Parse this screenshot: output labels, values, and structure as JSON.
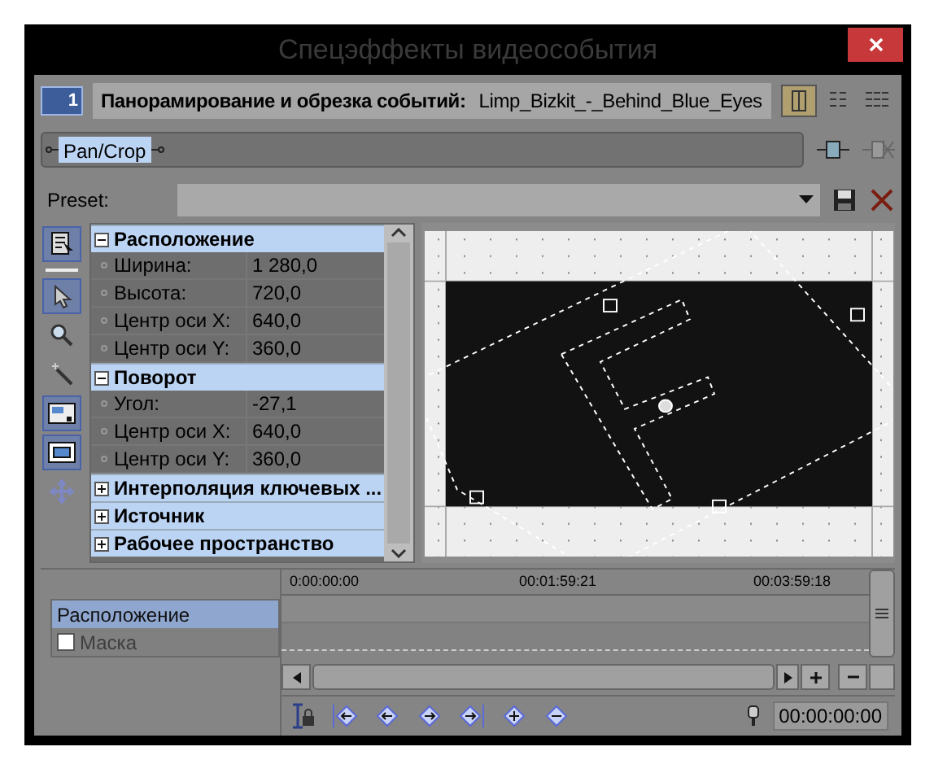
{
  "window": {
    "title": "Спецэффекты видеособытия"
  },
  "header": {
    "track_number": "1",
    "label": "Панорамирование и обрезка событий:",
    "event": "Limp_Bizkit_-_Behind_Blue_Eyes"
  },
  "view_buttons": [
    {
      "selected": true
    },
    {
      "selected": false
    },
    {
      "selected": false
    }
  ],
  "chain": {
    "plugins": [
      {
        "label": "Pan/Crop",
        "selected": true
      }
    ]
  },
  "preset": {
    "label": "Preset:"
  },
  "tools": [
    {
      "kind": "normal",
      "selected": true
    },
    {
      "kind": "normal",
      "selected": true
    },
    {
      "kind": "normal",
      "selected": false
    },
    {
      "kind": "normal",
      "selected": false
    },
    {
      "kind": "normal",
      "selected": true
    },
    {
      "kind": "normal",
      "selected": true
    },
    {
      "kind": "disabled",
      "selected": false
    }
  ],
  "properties": {
    "groups": [
      {
        "title": "Расположение",
        "expanded": true,
        "rows": [
          {
            "name": "Ширина:",
            "value": "1 280,0"
          },
          {
            "name": "Высота:",
            "value": "720,0"
          },
          {
            "name": "Центр оси X:",
            "value": "640,0"
          },
          {
            "name": "Центр оси Y:",
            "value": "360,0"
          }
        ]
      },
      {
        "title": "Поворот",
        "expanded": true,
        "rows": [
          {
            "name": "Угол:",
            "value": "-27,1"
          },
          {
            "name": "Центр оси X:",
            "value": "640,0"
          },
          {
            "name": "Центр оси Y:",
            "value": "360,0"
          }
        ]
      },
      {
        "title": "Интерполяция ключевых ...",
        "expanded": false
      },
      {
        "title": "Источник",
        "expanded": false
      },
      {
        "title": "Рабочее пространство",
        "expanded": false
      }
    ]
  },
  "keyframe_tracks": [
    {
      "label": "Расположение",
      "selected": true,
      "disabled": false
    },
    {
      "label": "Маска",
      "selected": false,
      "disabled": true,
      "checked": false
    }
  ],
  "timeline": {
    "ticks": [
      "0:00:00:00",
      "00:01:59:21",
      "00:03:59:18"
    ]
  },
  "cursor_time": "00:00:00:00"
}
